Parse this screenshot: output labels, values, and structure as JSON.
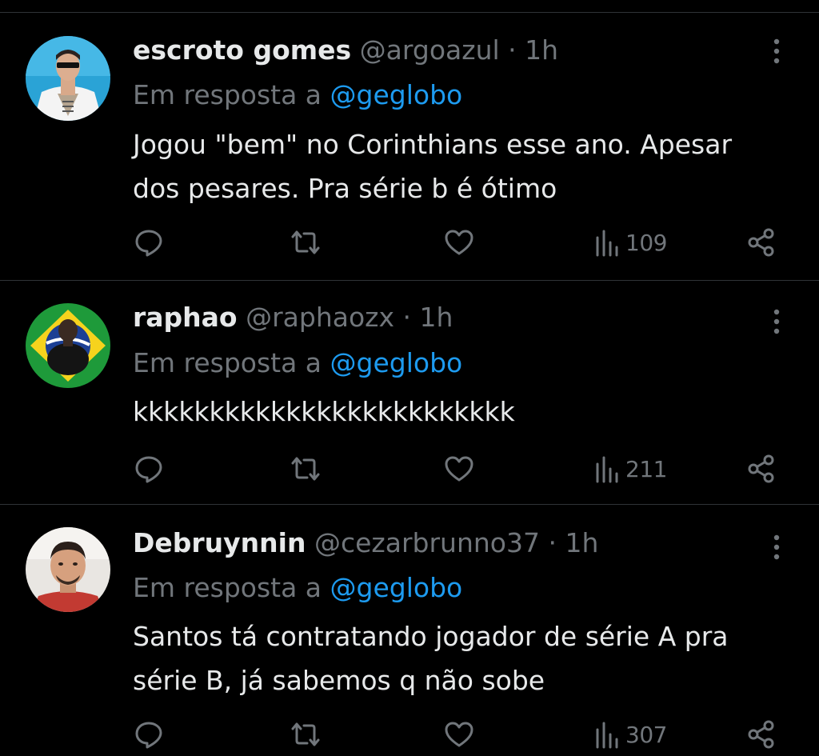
{
  "theme": {
    "background": "#000000",
    "text": "#e7e9ea",
    "muted": "#71767b",
    "mention": "#1d9bf0",
    "divider": "#2f3336"
  },
  "reply_prefix": "Em resposta a",
  "tweets": [
    {
      "display_name": "escroto gomes",
      "handle": "@argoazul",
      "separator": "·",
      "time": "1h",
      "reply_to": "@geglobo",
      "text_lines": [
        "Jogou \"bem\" no Corinthians esse ano. Apesar",
        "dos pesares. Pra série b é ótimo"
      ],
      "views": "109",
      "avatar_icon": "avatar-man-sunglasses-white-jacket"
    },
    {
      "display_name": "raphao",
      "handle": "@raphaozx",
      "separator": "·",
      "time": "1h",
      "reply_to": "@geglobo",
      "text_lines": [
        "kkkkkkkkkkkkkkkkkkkkkkkkk"
      ],
      "views": "211",
      "avatar_icon": "avatar-brazil-flag"
    },
    {
      "display_name": "Debruynnin",
      "handle": "@cezarbrunno37",
      "separator": "·",
      "time": "1h",
      "reply_to": "@geglobo",
      "text_lines": [
        "Santos tá contratando jogador de série A pra",
        "série B, já sabemos q não sobe"
      ],
      "views": "307",
      "avatar_icon": "avatar-young-man-selfie"
    }
  ]
}
